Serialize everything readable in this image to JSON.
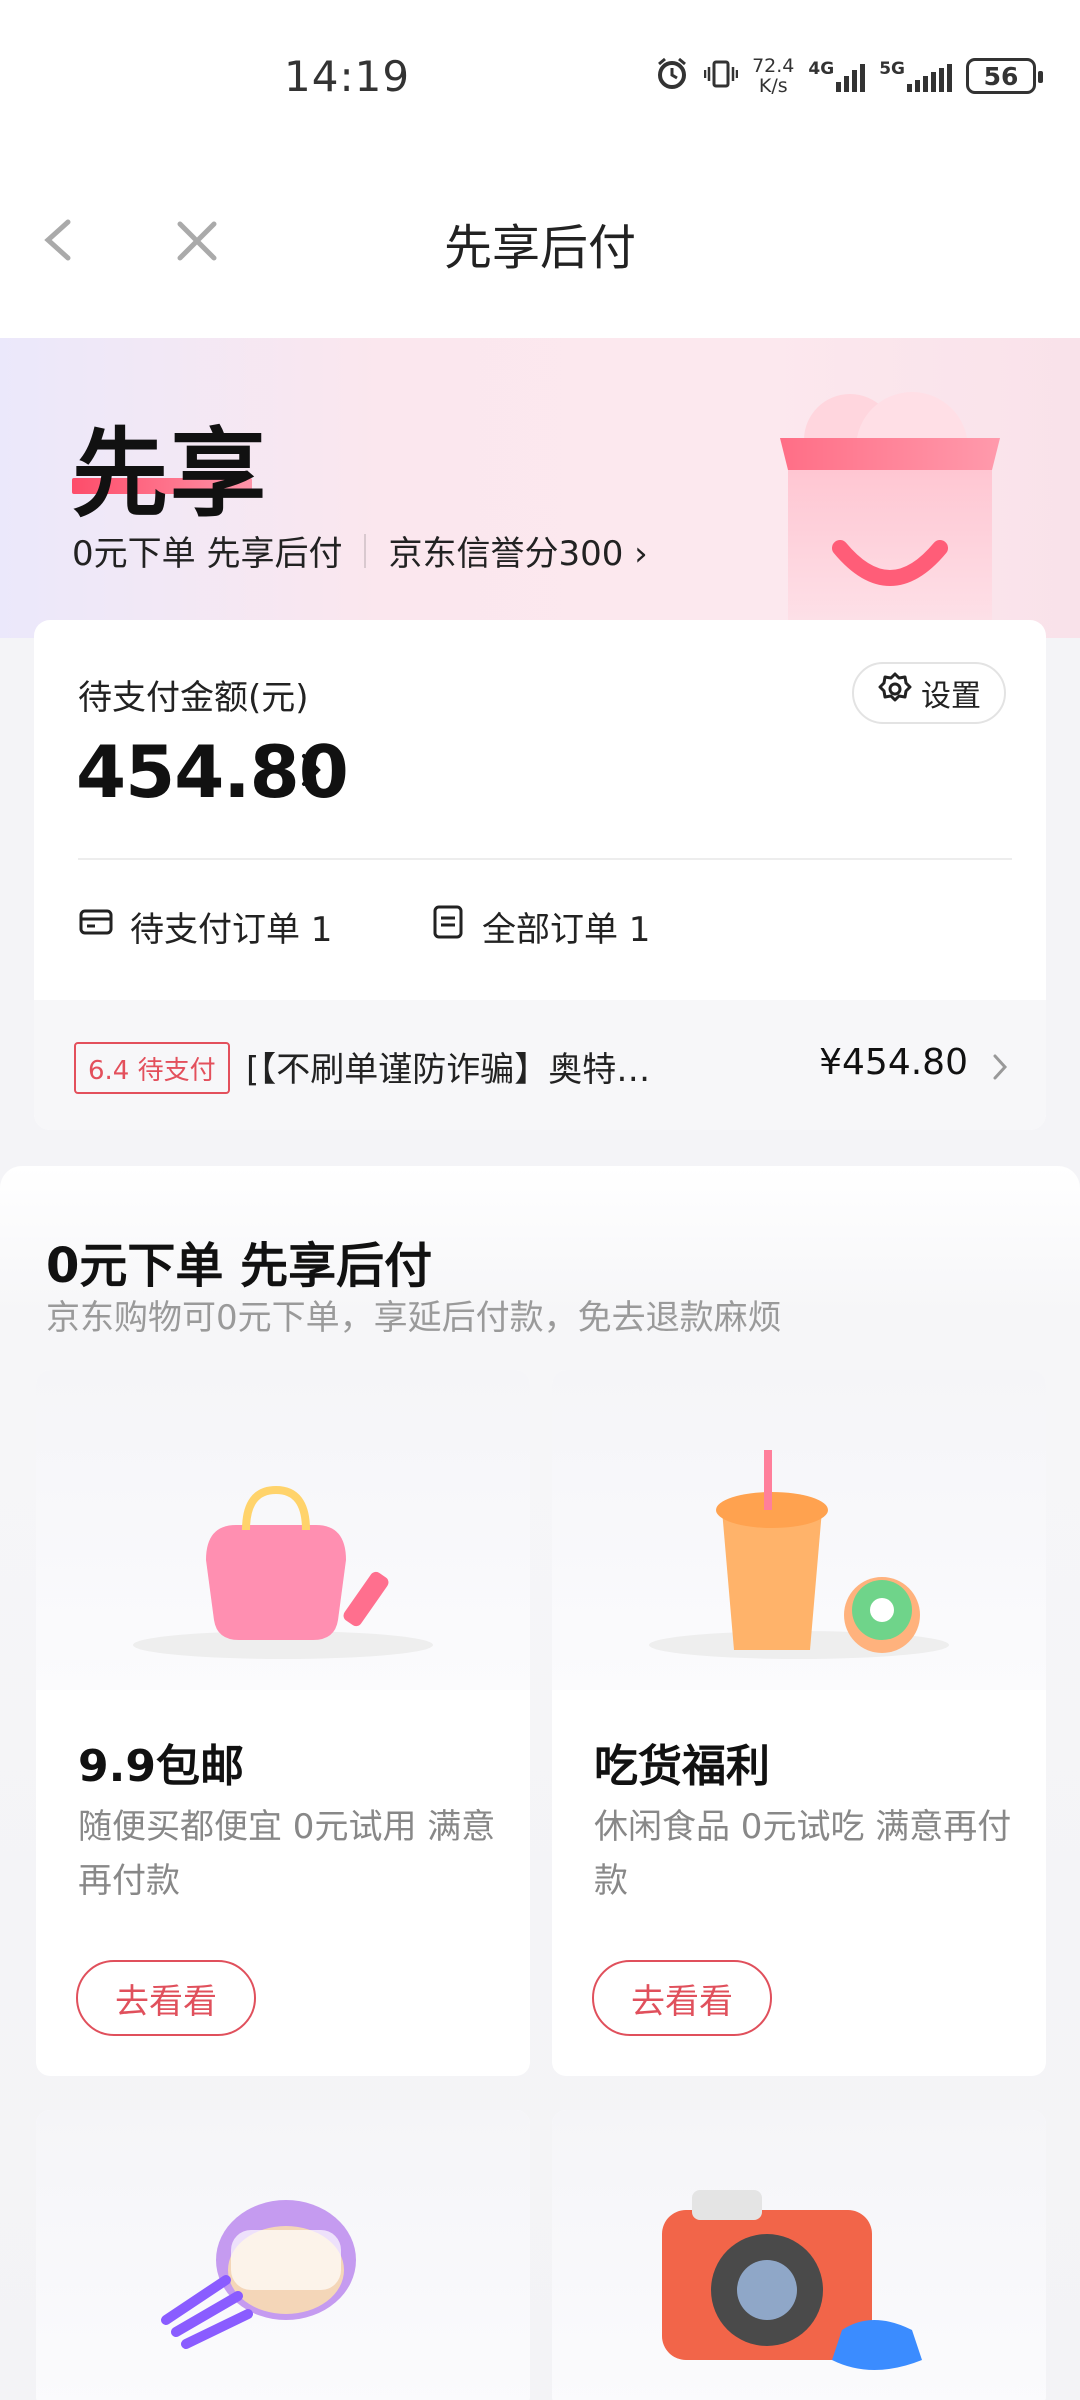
{
  "status_bar": {
    "time": "14:19",
    "net_speed_value": "72.4",
    "net_speed_unit": "K/s",
    "net1": "4G",
    "net2": "5G",
    "battery": "56",
    "icons": [
      "alarm-icon",
      "vibrate-icon",
      "signal-icon",
      "signal-icon",
      "battery-icon"
    ]
  },
  "nav": {
    "title": "先享后付",
    "back_icon": "chevron-left-icon",
    "close_icon": "close-icon"
  },
  "hero": {
    "title": "先享",
    "tagline": "0元下单 先享后付",
    "credit_link": "京东信誉分300 ›"
  },
  "pay_card": {
    "amount_label": "待支付金额(元)",
    "amount": "454.80",
    "settings_label": "设置",
    "pending_orders": "待支付订单 1",
    "all_orders": "全部订单 1",
    "pending_item": {
      "tag": "6.4 待支付",
      "name": "[【不刷单谨防诈骗】奥特…",
      "price": "¥454.80"
    }
  },
  "promo": {
    "title": "0元下单 先享后付",
    "subtitle": "京东购物可0元下单，享延后付款，免去退款麻烦",
    "cards": [
      {
        "title": "9.9包邮",
        "desc": "随便买都便宜 0元试用 满意再付款",
        "button": "去看看",
        "image_icon": "shopping-bag-icon"
      },
      {
        "title": "吃货福利",
        "desc": "休闲食品 0元试吃 满意再付款",
        "button": "去看看",
        "image_icon": "coffee-donut-icon"
      },
      {
        "title": "",
        "desc": "",
        "button": "",
        "image_icon": "cosmetics-icon"
      },
      {
        "title": "",
        "desc": "",
        "button": "",
        "image_icon": "camera-icon"
      }
    ]
  },
  "colors": {
    "accent_red": "#e3505c",
    "hero_gradient_start": "#ebe8fb",
    "hero_gradient_end": "#f9e2ea"
  }
}
